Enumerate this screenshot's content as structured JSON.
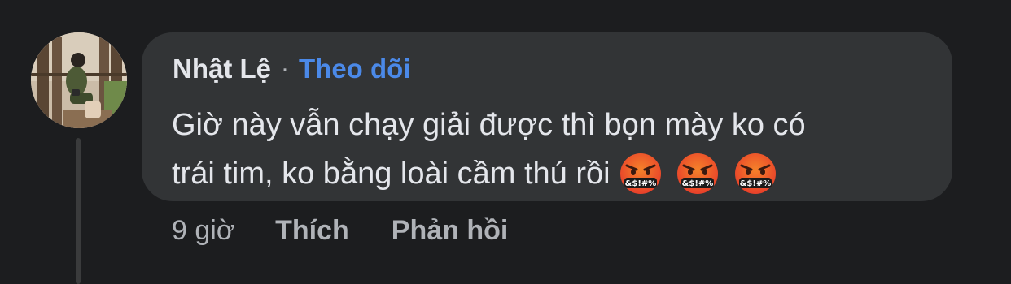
{
  "comment": {
    "author": "Nhật Lệ",
    "separator": "·",
    "follow_label": "Theo dõi",
    "text_line1": "Giờ này vẫn chạy giải được thì bọn mày ko có",
    "text_line2": "trái tim, ko bằng loài cầm thú rồi",
    "emojis": [
      {
        "name": "face-with-symbols-on-mouth",
        "symbols": "&$!#%"
      },
      {
        "name": "face-with-symbols-on-mouth",
        "symbols": "&$!#%"
      },
      {
        "name": "face-with-symbols-on-mouth",
        "symbols": "&$!#%"
      }
    ]
  },
  "actions": {
    "timestamp": "9 giờ",
    "like_label": "Thích",
    "reply_label": "Phản hồi"
  },
  "colors": {
    "background": "#1c1d1f",
    "bubble": "#323436",
    "primary_text": "#e4e6eb",
    "secondary_text": "#b0b3b8",
    "link_blue": "#4b89e8",
    "emoji_red": "#e8402a",
    "emoji_orange": "#f5822a"
  }
}
